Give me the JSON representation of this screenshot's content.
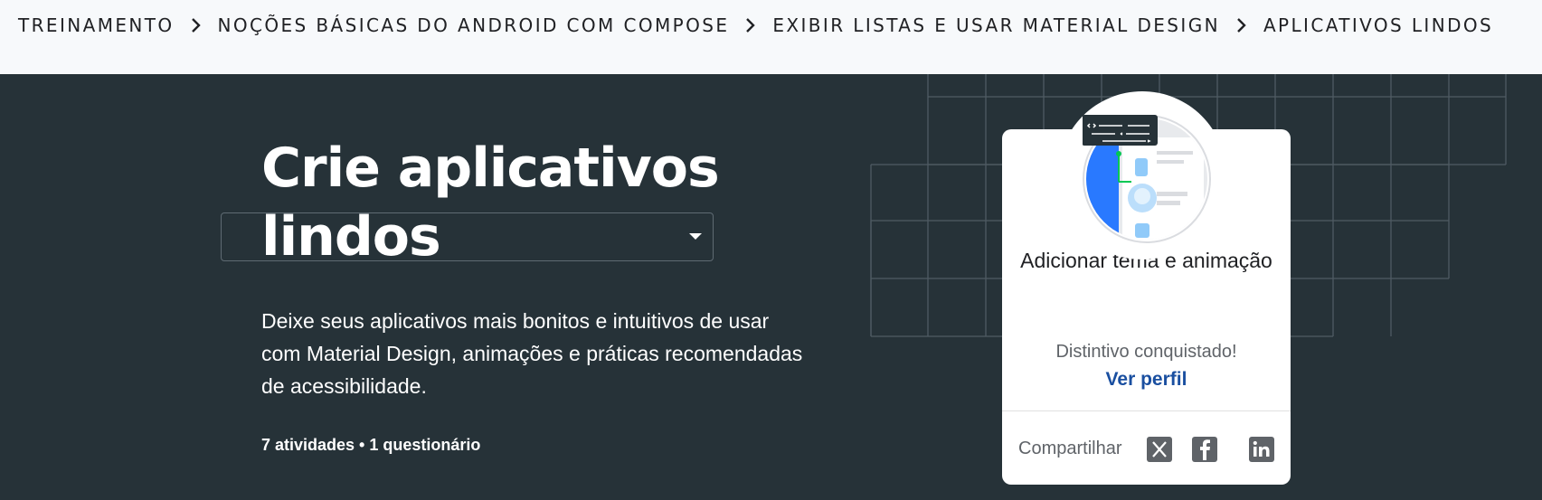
{
  "breadcrumb": {
    "items": [
      {
        "label": "TREINAMENTO"
      },
      {
        "label": "NOÇÕES BÁSICAS DO ANDROID COM COMPOSE"
      },
      {
        "label": "EXIBIR LISTAS E USAR MATERIAL DESIGN"
      },
      {
        "label": "APLICATIVOS LINDOS"
      }
    ]
  },
  "hero": {
    "title_line1": "Crie aplicativos",
    "title_line2": "lindos",
    "description": "Deixe seus aplicativos mais bonitos e intuitivos de usar com Material Design, animações e práticas recomendadas de acessibilidade.",
    "meta": "7 atividades • 1 questionário"
  },
  "badge_card": {
    "title": "Adicionar tema e animação",
    "earned_text": "Distintivo conquistado!",
    "profile_link": "Ver perfil",
    "share_label": "Compartilhar",
    "social": [
      {
        "icon": "x-icon"
      },
      {
        "icon": "facebook-icon"
      },
      {
        "icon": "linkedin-icon"
      }
    ]
  },
  "colors": {
    "hero_background": "#263238",
    "breadcrumb_background": "#f7f9fb",
    "link": "#1a4fa0",
    "badge_blue": "#2979ff"
  }
}
